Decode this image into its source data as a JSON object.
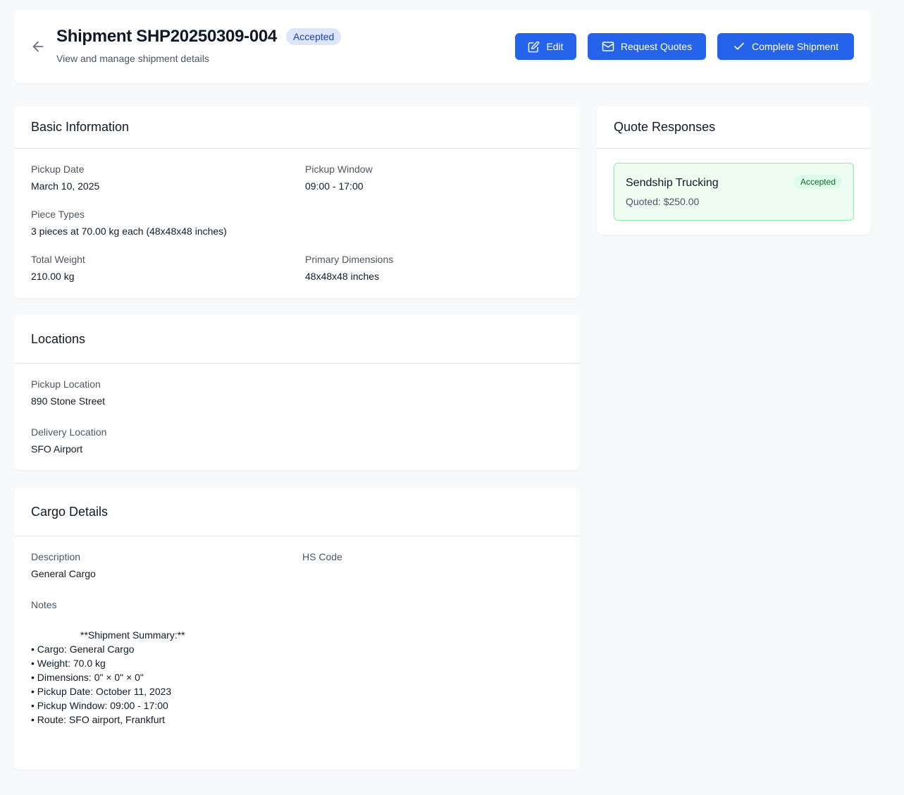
{
  "header": {
    "back_icon": "arrow-left-icon",
    "title": "Shipment SHP20250309-004",
    "status": "Accepted",
    "subtitle": "View and manage shipment details",
    "buttons": {
      "edit": {
        "label": "Edit",
        "icon": "edit-icon"
      },
      "request_quotes": {
        "label": "Request Quotes",
        "icon": "mail-icon"
      },
      "complete": {
        "label": "Complete Shipment",
        "icon": "check-icon"
      }
    }
  },
  "basic_info": {
    "title": "Basic Information",
    "pickup_date_label": "Pickup Date",
    "pickup_date": "March 10, 2025",
    "pickup_window_label": "Pickup Window",
    "pickup_window": "09:00 - 17:00",
    "piece_types_label": "Piece Types",
    "piece_types": "3 pieces at 70.00 kg each (48x48x48 inches)",
    "total_weight_label": "Total Weight",
    "total_weight": "210.00 kg",
    "primary_dimensions_label": "Primary Dimensions",
    "primary_dimensions": "48x48x48 inches"
  },
  "locations": {
    "title": "Locations",
    "pickup_label": "Pickup Location",
    "pickup": "890 Stone Street",
    "delivery_label": "Delivery Location",
    "delivery": "SFO Airport"
  },
  "cargo": {
    "title": "Cargo Details",
    "description_label": "Description",
    "description": "General Cargo",
    "hs_code_label": "HS Code",
    "hs_code": "",
    "notes_label": "Notes",
    "notes": "                  **Shipment Summary:**\n• Cargo: General Cargo\n• Weight: 70.0 kg\n• Dimensions: 0\" × 0\" × 0\"\n• Pickup Date: October 11, 2023\n• Pickup Window: 09:00 - 17:00\n• Route: SFO airport, Frankfurt"
  },
  "quotes": {
    "title": "Quote Responses",
    "items": [
      {
        "carrier": "Sendship Trucking",
        "price": "Quoted: $250.00",
        "status": "Accepted"
      }
    ]
  },
  "colors": {
    "primary": "#2563eb",
    "status_blue_bg": "#dbe6fb",
    "accepted_green_bg": "#effcf2",
    "accepted_green_border": "#86efac"
  }
}
